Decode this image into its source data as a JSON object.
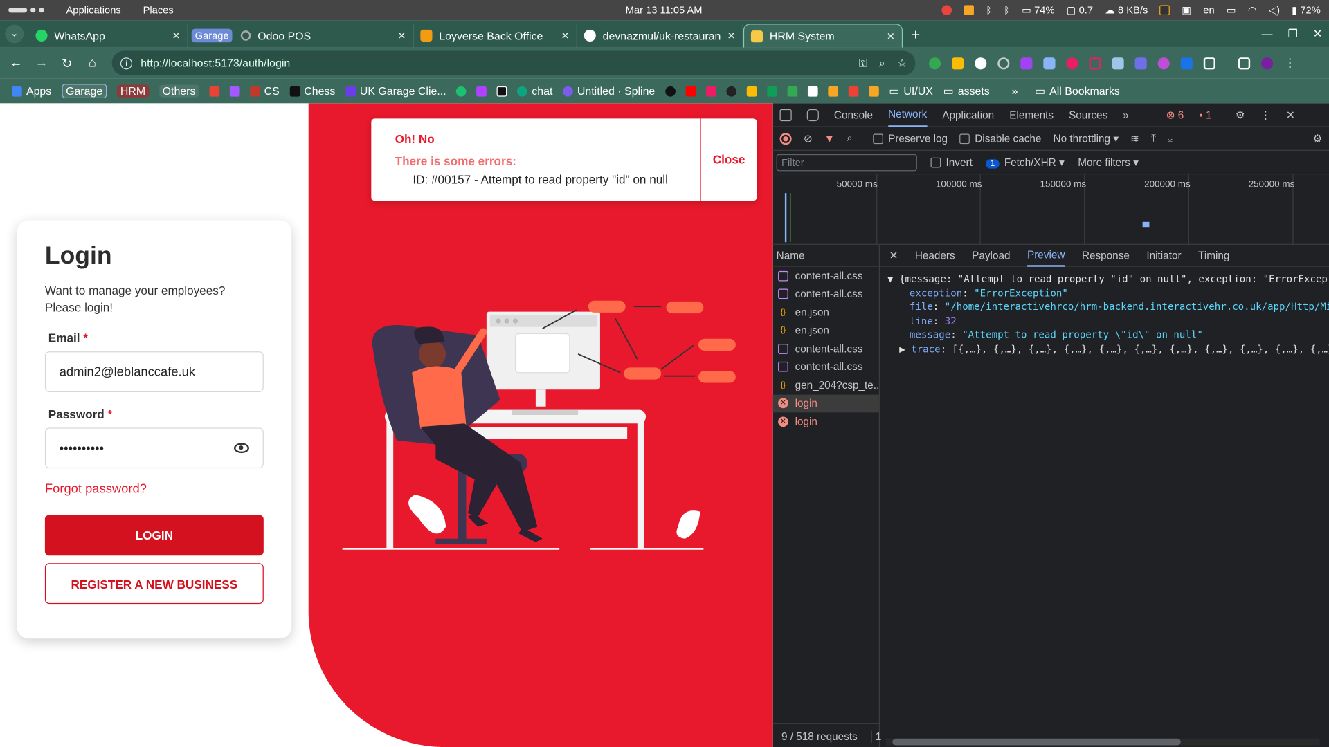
{
  "os": {
    "menu": [
      "Applications",
      "Places"
    ],
    "clock": "Mar 13  11:05 AM",
    "battery_text": "74%",
    "load": "0.7",
    "net": "8 KB/s",
    "lang": "en",
    "battery2": "72%"
  },
  "tabs": [
    {
      "title": "WhatsApp",
      "color": "#25d366"
    },
    {
      "group": "Garage",
      "title": "Odoo POS",
      "color": "#aaaaaa"
    },
    {
      "title": "Loyverse Back Office",
      "color": "#f39c12"
    },
    {
      "title": "devnazmul/uk-restauran",
      "color": "#ffffff"
    },
    {
      "title": "HRM System",
      "color": "#f7c948"
    }
  ],
  "address": {
    "url": "http://localhost:5173/auth/login"
  },
  "bookmarks": [
    "Apps",
    "Garage",
    "HRM",
    "Others",
    "CS",
    "Chess",
    "UK Garage Clie...",
    "chat",
    "Untitled · Spline",
    "UI/UX",
    "assets",
    "All Bookmarks"
  ],
  "login": {
    "title": "Login",
    "subtitle": "Want to manage your employees? Please login!",
    "email_label": "Email",
    "email_value": "admin2@leblanccafe.uk",
    "password_label": "Password",
    "password_value": "••••••••••",
    "forgot": "Forgot password?",
    "login_btn": "LOGIN",
    "register_btn": "REGISTER A NEW BUSINESS"
  },
  "alert": {
    "title": "Oh! No",
    "subtitle": "There is some errors:",
    "message": "ID: #00157 - Attempt to read property \"id\" on null",
    "close": "Close"
  },
  "devtools": {
    "tabs": [
      "Console",
      "Network",
      "Application",
      "Elements",
      "Sources"
    ],
    "error_count": "6",
    "warn_count": "1",
    "preserve_log": "Preserve log",
    "disable_cache": "Disable cache",
    "throttling": "No throttling",
    "filter_placeholder": "Filter",
    "invert": "Invert",
    "fetch_count": "1",
    "fetch": "Fetch/XHR",
    "more_filters": "More filters",
    "timeline_labels": [
      "50000 ms",
      "100000 ms",
      "150000 ms",
      "200000 ms",
      "250000 ms"
    ],
    "name_header": "Name",
    "requests": [
      "content-all.css",
      "content-all.css",
      "en.json",
      "en.json",
      "content-all.css",
      "content-all.css",
      "gen_204?csp_te...",
      "login",
      "login"
    ],
    "footer": "9 / 518 requests",
    "footer2": "1",
    "detail_tabs": [
      "Headers",
      "Payload",
      "Preview",
      "Response",
      "Initiator",
      "Timing"
    ],
    "preview": {
      "summary": "{message: \"Attempt to read property \"id\" on null\", exception: \"ErrorExcepti",
      "exception_key": "exception",
      "exception_val": "\"ErrorException\"",
      "file_key": "file",
      "file_val": "\"/home/interactivehrco/hrm-backend.interactivehr.co.uk/app/Http/Mid",
      "line_key": "line",
      "line_val": "32",
      "message_key": "message",
      "message_val": "\"Attempt to read property \\\"id\\\" on null\"",
      "trace_key": "trace",
      "trace_val": "[{,…}, {,…}, {,…}, {,…}, {,…}, {,…}, {,…}, {,…}, {,…}, {,…}, {,…},"
    }
  }
}
